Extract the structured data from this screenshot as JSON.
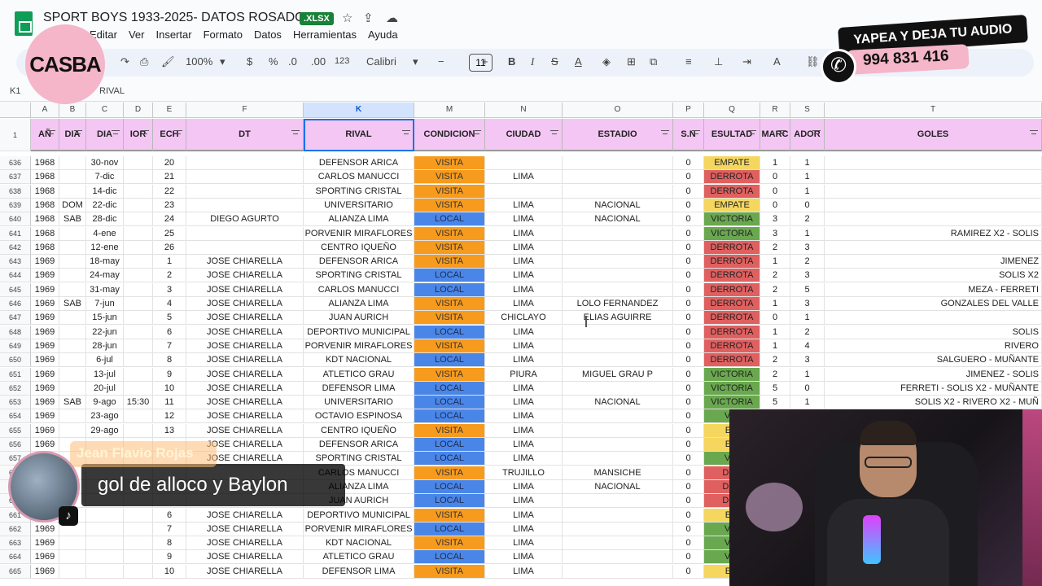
{
  "doc": {
    "title": "SPORT BOYS 1933-2025- DATOS ROSADOS",
    "badge": ".XLSX",
    "menu": [
      "Editar",
      "Ver",
      "Insertar",
      "Formato",
      "Datos",
      "Herramientas",
      "Ayuda"
    ]
  },
  "toolbar": {
    "zoom": "100%",
    "currency": "$",
    "percent": "%",
    "dec_less": ".0",
    "dec_more": ".00",
    "format123": "123",
    "font": "Calibri",
    "font_size": "11",
    "minus": "−",
    "plus": "+"
  },
  "formula_bar": {
    "cell_ref": "K1",
    "content": "RIVAL"
  },
  "columns": [
    {
      "letter": "A",
      "header": "AÑ"
    },
    {
      "letter": "B",
      "header": "DIA"
    },
    {
      "letter": "C",
      "header": "DIA"
    },
    {
      "letter": "D",
      "header": "IOR"
    },
    {
      "letter": "E",
      "header": "ECH"
    },
    {
      "letter": "F",
      "header": "DT"
    },
    {
      "letter": "K",
      "header": "RIVAL"
    },
    {
      "letter": "M",
      "header": "CONDICION"
    },
    {
      "letter": "N",
      "header": "CIUDAD"
    },
    {
      "letter": "O",
      "header": "ESTADIO"
    },
    {
      "letter": "P",
      "header": "S.N"
    },
    {
      "letter": "Q",
      "header": "ESULTAD"
    },
    {
      "letter": "R",
      "header": "MARC"
    },
    {
      "letter": "S",
      "header": "ADOR"
    },
    {
      "letter": "T",
      "header": "GOLES"
    }
  ],
  "header_row_number": "1",
  "rows": [
    {
      "n": "636",
      "a": "1968",
      "b": "",
      "c": "30-nov",
      "d": "",
      "e": "20",
      "f": "",
      "k": "DEFENSOR ARICA",
      "m": "VISITA",
      "ncity": "",
      "o": "",
      "p": "0",
      "q": "EMPATE",
      "r": "1",
      "s": "1",
      "t": ""
    },
    {
      "n": "637",
      "a": "1968",
      "b": "",
      "c": "7-dic",
      "d": "",
      "e": "21",
      "f": "",
      "k": "CARLOS MANUCCI",
      "m": "VISITA",
      "ncity": "LIMA",
      "o": "",
      "p": "0",
      "q": "DERROTA",
      "r": "0",
      "s": "1",
      "t": ""
    },
    {
      "n": "638",
      "a": "1968",
      "b": "",
      "c": "14-dic",
      "d": "",
      "e": "22",
      "f": "",
      "k": "SPORTING CRISTAL",
      "m": "VISITA",
      "ncity": "",
      "o": "",
      "p": "0",
      "q": "DERROTA",
      "r": "0",
      "s": "1",
      "t": ""
    },
    {
      "n": "639",
      "a": "1968",
      "b": "DOM",
      "c": "22-dic",
      "d": "",
      "e": "23",
      "f": "",
      "k": "UNIVERSITARIO",
      "m": "VISITA",
      "ncity": "LIMA",
      "o": "NACIONAL",
      "p": "0",
      "q": "EMPATE",
      "r": "0",
      "s": "0",
      "t": ""
    },
    {
      "n": "640",
      "a": "1968",
      "b": "SAB",
      "c": "28-dic",
      "d": "",
      "e": "24",
      "f": "DIEGO AGURTO",
      "k": "ALIANZA LIMA",
      "m": "LOCAL",
      "ncity": "LIMA",
      "o": "NACIONAL",
      "p": "0",
      "q": "VICTORIA",
      "r": "3",
      "s": "2",
      "t": ""
    },
    {
      "n": "641",
      "a": "1968",
      "b": "",
      "c": "4-ene",
      "d": "",
      "e": "25",
      "f": "",
      "k": "PORVENIR MIRAFLORES",
      "m": "VISITA",
      "ncity": "LIMA",
      "o": "",
      "p": "0",
      "q": "VICTORIA",
      "r": "3",
      "s": "1",
      "t": "RAMIREZ X2 - SOLIS"
    },
    {
      "n": "642",
      "a": "1968",
      "b": "",
      "c": "12-ene",
      "d": "",
      "e": "26",
      "f": "",
      "k": "CENTRO IQUEÑO",
      "m": "VISITA",
      "ncity": "LIMA",
      "o": "",
      "p": "0",
      "q": "DERROTA",
      "r": "2",
      "s": "3",
      "t": ""
    },
    {
      "n": "643",
      "a": "1969",
      "b": "",
      "c": "18-may",
      "d": "",
      "e": "1",
      "f": "JOSE CHIARELLA",
      "k": "DEFENSOR ARICA",
      "m": "VISITA",
      "ncity": "LIMA",
      "o": "",
      "p": "0",
      "q": "DERROTA",
      "r": "1",
      "s": "2",
      "t": "JIMENEZ"
    },
    {
      "n": "644",
      "a": "1969",
      "b": "",
      "c": "24-may",
      "d": "",
      "e": "2",
      "f": "JOSE CHIARELLA",
      "k": "SPORTING CRISTAL",
      "m": "LOCAL",
      "ncity": "LIMA",
      "o": "",
      "p": "0",
      "q": "DERROTA",
      "r": "2",
      "s": "3",
      "t": "SOLIS X2"
    },
    {
      "n": "645",
      "a": "1969",
      "b": "",
      "c": "31-may",
      "d": "",
      "e": "3",
      "f": "JOSE CHIARELLA",
      "k": "CARLOS MANUCCI",
      "m": "LOCAL",
      "ncity": "LIMA",
      "o": "",
      "p": "0",
      "q": "DERROTA",
      "r": "2",
      "s": "5",
      "t": "MEZA - FERRETI"
    },
    {
      "n": "646",
      "a": "1969",
      "b": "SAB",
      "c": "7-jun",
      "d": "",
      "e": "4",
      "f": "JOSE CHIARELLA",
      "k": "ALIANZA LIMA",
      "m": "VISITA",
      "ncity": "LIMA",
      "o": "LOLO FERNANDEZ",
      "p": "0",
      "q": "DERROTA",
      "r": "1",
      "s": "3",
      "t": "GONZALES DEL VALLE"
    },
    {
      "n": "647",
      "a": "1969",
      "b": "",
      "c": "15-jun",
      "d": "",
      "e": "5",
      "f": "JOSE CHIARELLA",
      "k": "JUAN AURICH",
      "m": "VISITA",
      "ncity": "CHICLAYO",
      "o": "ELIAS AGUIRRE",
      "p": "0",
      "q": "DERROTA",
      "r": "0",
      "s": "1",
      "t": ""
    },
    {
      "n": "648",
      "a": "1969",
      "b": "",
      "c": "22-jun",
      "d": "",
      "e": "6",
      "f": "JOSE CHIARELLA",
      "k": "DEPORTIVO MUNICIPAL",
      "m": "LOCAL",
      "ncity": "LIMA",
      "o": "",
      "p": "0",
      "q": "DERROTA",
      "r": "1",
      "s": "2",
      "t": "SOLIS"
    },
    {
      "n": "649",
      "a": "1969",
      "b": "",
      "c": "28-jun",
      "d": "",
      "e": "7",
      "f": "JOSE CHIARELLA",
      "k": "PORVENIR MIRAFLORES",
      "m": "VISITA",
      "ncity": "LIMA",
      "o": "",
      "p": "0",
      "q": "DERROTA",
      "r": "1",
      "s": "4",
      "t": "RIVERO"
    },
    {
      "n": "650",
      "a": "1969",
      "b": "",
      "c": "6-jul",
      "d": "",
      "e": "8",
      "f": "JOSE CHIARELLA",
      "k": "KDT NACIONAL",
      "m": "LOCAL",
      "ncity": "LIMA",
      "o": "",
      "p": "0",
      "q": "DERROTA",
      "r": "2",
      "s": "3",
      "t": "SALGUERO - MUÑANTE"
    },
    {
      "n": "651",
      "a": "1969",
      "b": "",
      "c": "13-jul",
      "d": "",
      "e": "9",
      "f": "JOSE CHIARELLA",
      "k": "ATLETICO GRAU",
      "m": "VISITA",
      "ncity": "PIURA",
      "o": "MIGUEL GRAU P",
      "p": "0",
      "q": "VICTORIA",
      "r": "2",
      "s": "1",
      "t": "JIMENEZ - SOLIS"
    },
    {
      "n": "652",
      "a": "1969",
      "b": "",
      "c": "20-jul",
      "d": "",
      "e": "10",
      "f": "JOSE CHIARELLA",
      "k": "DEFENSOR LIMA",
      "m": "LOCAL",
      "ncity": "LIMA",
      "o": "",
      "p": "0",
      "q": "VICTORIA",
      "r": "5",
      "s": "0",
      "t": "FERRETI - SOLIS X2 - MUÑANTE"
    },
    {
      "n": "653",
      "a": "1969",
      "b": "SAB",
      "c": "9-ago",
      "d": "15:30",
      "e": "11",
      "f": "JOSE CHIARELLA",
      "k": "UNIVERSITARIO",
      "m": "LOCAL",
      "ncity": "LIMA",
      "o": "NACIONAL",
      "p": "0",
      "q": "VICTORIA",
      "r": "5",
      "s": "1",
      "t": "SOLIS X2 - RIVERO X2 - MUÑ"
    },
    {
      "n": "654",
      "a": "1969",
      "b": "",
      "c": "23-ago",
      "d": "",
      "e": "12",
      "f": "JOSE CHIARELLA",
      "k": "OCTAVIO ESPINOSA",
      "m": "LOCAL",
      "ncity": "LIMA",
      "o": "",
      "p": "0",
      "q": "VIC",
      "r": "",
      "s": "",
      "t": ""
    },
    {
      "n": "655",
      "a": "1969",
      "b": "",
      "c": "29-ago",
      "d": "",
      "e": "13",
      "f": "JOSE CHIARELLA",
      "k": "CENTRO IQUEÑO",
      "m": "VISITA",
      "ncity": "LIMA",
      "o": "",
      "p": "0",
      "q": "EM",
      "r": "",
      "s": "",
      "t": ""
    },
    {
      "n": "656",
      "a": "1969",
      "b": "",
      "c": "",
      "d": "",
      "e": "",
      "f": "JOSE CHIARELLA",
      "k": "DEFENSOR ARICA",
      "m": "LOCAL",
      "ncity": "LIMA",
      "o": "",
      "p": "0",
      "q": "EM",
      "r": "",
      "s": "",
      "t": ""
    },
    {
      "n": "657",
      "a": "",
      "b": "",
      "c": "",
      "d": "",
      "e": "",
      "f": "JOSE CHIARELLA",
      "k": "SPORTING CRISTAL",
      "m": "LOCAL",
      "ncity": "LIMA",
      "o": "",
      "p": "0",
      "q": "VIC",
      "r": "",
      "s": "",
      "t": ""
    },
    {
      "n": "658",
      "a": "",
      "b": "",
      "c": "",
      "d": "",
      "e": "",
      "f": "",
      "k": "CARLOS MANUCCI",
      "m": "VISITA",
      "ncity": "TRUJILLO",
      "o": "MANSICHE",
      "p": "0",
      "q": "DER",
      "r": "",
      "s": "",
      "t": ""
    },
    {
      "n": "659",
      "a": "",
      "b": "",
      "c": "",
      "d": "",
      "e": "",
      "f": "",
      "k": "ALIANZA LIMA",
      "m": "LOCAL",
      "ncity": "LIMA",
      "o": "NACIONAL",
      "p": "0",
      "q": "DER",
      "r": "",
      "s": "",
      "t": ""
    },
    {
      "n": "660",
      "a": "",
      "b": "",
      "c": "",
      "d": "",
      "e": "",
      "f": "",
      "k": "JUAN AURICH",
      "m": "LOCAL",
      "ncity": "LIMA",
      "o": "",
      "p": "0",
      "q": "DER",
      "r": "",
      "s": "",
      "t": ""
    },
    {
      "n": "661",
      "a": "",
      "b": "",
      "c": "",
      "d": "",
      "e": "6",
      "f": "JOSE CHIARELLA",
      "k": "DEPORTIVO MUNICIPAL",
      "m": "VISITA",
      "ncity": "LIMA",
      "o": "",
      "p": "0",
      "q": "EM",
      "r": "",
      "s": "",
      "t": ""
    },
    {
      "n": "662",
      "a": "1969",
      "b": "",
      "c": "",
      "d": "",
      "e": "7",
      "f": "JOSE CHIARELLA",
      "k": "PORVENIR MIRAFLORES",
      "m": "LOCAL",
      "ncity": "LIMA",
      "o": "",
      "p": "0",
      "q": "VIC",
      "r": "",
      "s": "",
      "t": ""
    },
    {
      "n": "663",
      "a": "1969",
      "b": "",
      "c": "",
      "d": "",
      "e": "8",
      "f": "JOSE CHIARELLA",
      "k": "KDT NACIONAL",
      "m": "VISITA",
      "ncity": "LIMA",
      "o": "",
      "p": "0",
      "q": "VIC",
      "r": "",
      "s": "",
      "t": ""
    },
    {
      "n": "664",
      "a": "1969",
      "b": "",
      "c": "",
      "d": "",
      "e": "9",
      "f": "JOSE CHIARELLA",
      "k": "ATLETICO GRAU",
      "m": "LOCAL",
      "ncity": "LIMA",
      "o": "",
      "p": "0",
      "q": "VIC",
      "r": "",
      "s": "",
      "t": ""
    },
    {
      "n": "665",
      "a": "1969",
      "b": "",
      "c": "",
      "d": "",
      "e": "10",
      "f": "JOSE CHIARELLA",
      "k": "DEFENSOR LIMA",
      "m": "VISITA",
      "ncity": "LIMA",
      "o": "",
      "p": "0",
      "q": "EM",
      "r": "",
      "s": "",
      "t": ""
    }
  ],
  "overlays": {
    "brand": "CASBA",
    "yape_line1": "YAPEA Y DEJA TU AUDIO",
    "yape_phone": "994 831 416",
    "commenter": "Jean Flavio Rojas",
    "comment": "gol de alloco y Baylon",
    "tiktok": "♪"
  }
}
